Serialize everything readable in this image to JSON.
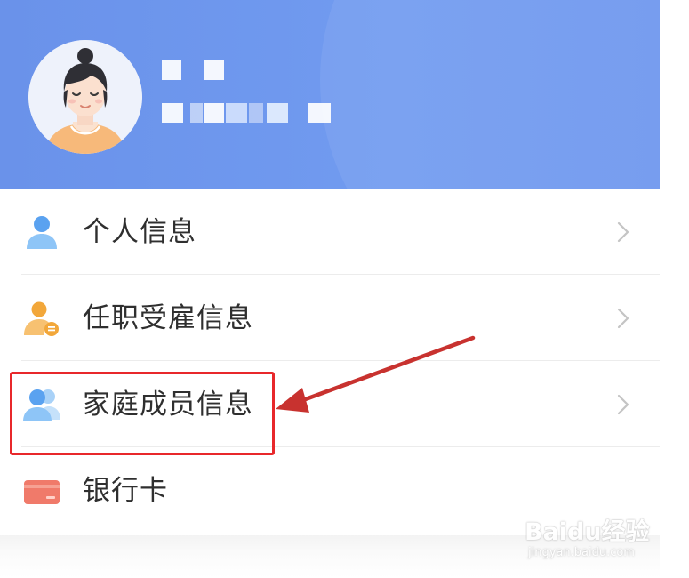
{
  "profile": {
    "avatar_icon": "female-avatar-illustration",
    "name_hidden": "pixelated-name",
    "id_hidden": "pixelated-id-number"
  },
  "menu": {
    "items": [
      {
        "label": "个人信息",
        "icon": "person-icon",
        "color": "#5aa2f0"
      },
      {
        "label": "任职受雇信息",
        "icon": "employee-badge-icon",
        "color": "#f2a73a"
      },
      {
        "label": "家庭成员信息",
        "icon": "family-members-icon",
        "color": "#5aa2f0"
      },
      {
        "label": "银行卡",
        "icon": "bank-card-icon",
        "color": "#f07a6a"
      }
    ]
  },
  "annotation": {
    "highlight_color": "#e8282b",
    "highlight_target": "家庭成员信息"
  },
  "watermark": {
    "main": "Baidu经验",
    "sub": "jingyan.baidu.com"
  },
  "colors": {
    "header": "#6d96ee",
    "accent_blue": "#5aa2f0"
  }
}
